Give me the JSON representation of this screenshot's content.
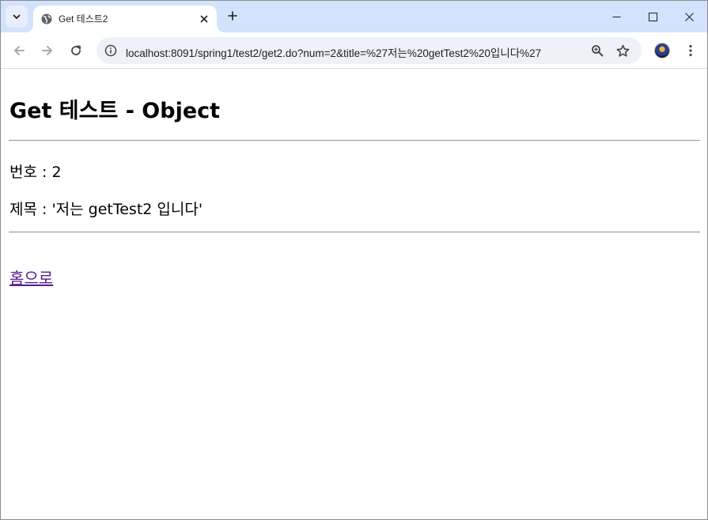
{
  "browser": {
    "tab_title": "Get 테스트2",
    "url": "localhost:8091/spring1/test2/get2.do?num=2&title=%27저는%20getTest2%20입니다%27",
    "icons": {
      "tab_search": "chevron-down-icon",
      "favicon": "globe-icon",
      "tab_close": "close-icon",
      "new_tab": "plus-icon",
      "minimize": "minimize-icon",
      "maximize": "maximize-icon",
      "close_window": "close-icon",
      "back": "back-arrow-icon",
      "forward": "forward-arrow-icon",
      "reload": "reload-icon",
      "site_info": "info-icon",
      "zoom": "zoom-icon",
      "bookmark": "star-icon",
      "profile": "avatar",
      "menu": "more-vert-icon"
    }
  },
  "page": {
    "heading": "Get 테스트 - Object",
    "number_line": "번호 : 2",
    "title_line": "제목 : '저는 getTest2 입니다'",
    "home_link": "홈으로"
  },
  "colors": {
    "tabstrip": "#d3e3fd",
    "omnibox": "#eef1f7",
    "visited_link": "#551a8b"
  }
}
